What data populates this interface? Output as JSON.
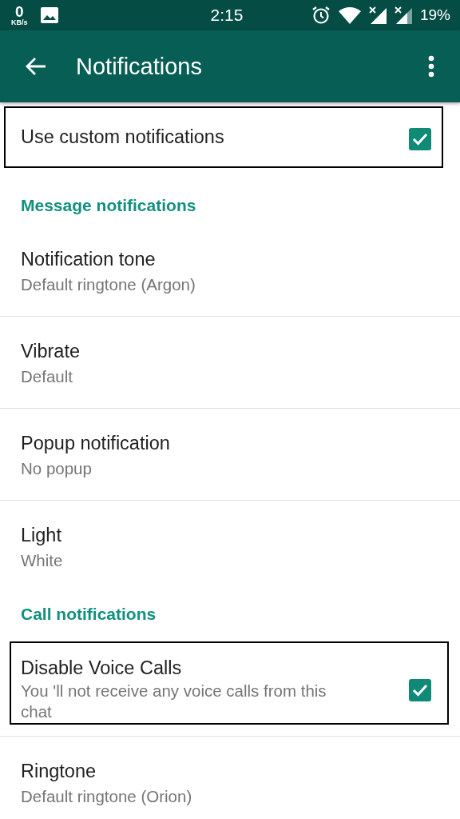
{
  "status_bar": {
    "speed": "0",
    "speed_unit": "KB/s",
    "time": "2:15",
    "battery": "19%"
  },
  "app_bar": {
    "title": "Notifications"
  },
  "items": [
    {
      "kind": "checkbox",
      "title": "Use custom notifications",
      "checked": true,
      "highlighted": true
    },
    {
      "kind": "header",
      "title": "Message notifications"
    },
    {
      "kind": "pref",
      "title": "Notification tone",
      "summary": "Default ringtone (Argon)",
      "highlighted": false
    },
    {
      "kind": "pref",
      "title": "Vibrate",
      "summary": "Default",
      "highlighted": false
    },
    {
      "kind": "pref",
      "title": "Popup notification",
      "summary": "No popup",
      "highlighted": false
    },
    {
      "kind": "pref",
      "title": "Light",
      "summary": "White",
      "highlighted": false
    },
    {
      "kind": "header",
      "title": "Call notifications"
    },
    {
      "kind": "checkbox",
      "title": "Disable Voice Calls",
      "summary": "You 'll not receive any voice calls from this chat",
      "checked": true,
      "highlighted": true
    },
    {
      "kind": "pref",
      "title": "Ringtone",
      "summary": "Default ringtone (Orion)",
      "highlighted": false
    }
  ]
}
